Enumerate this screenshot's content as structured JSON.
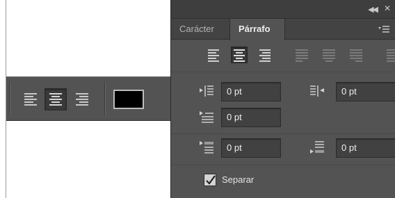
{
  "options_bar": {
    "buttons": [
      "align-left-icon",
      "align-center-icon",
      "align-right-icon"
    ],
    "active": "align-center",
    "text_color": "#000000"
  },
  "panel": {
    "tabs": [
      "Carácter",
      "Párrafo"
    ],
    "active_tab": "Párrafo",
    "alignment_buttons": [
      "align-left-icon",
      "align-center-icon",
      "align-right-icon",
      "justify-last-left-icon",
      "justify-last-center-icon",
      "justify-last-right-icon",
      "justify-all-icon"
    ],
    "active_alignment": "align-center",
    "indent_left": "0 pt",
    "indent_right": "0 pt",
    "indent_first_line": "0 pt",
    "space_before": "0 pt",
    "space_after": "0 pt",
    "hyphenate_label": "Separar",
    "hyphenate_checked": true
  }
}
